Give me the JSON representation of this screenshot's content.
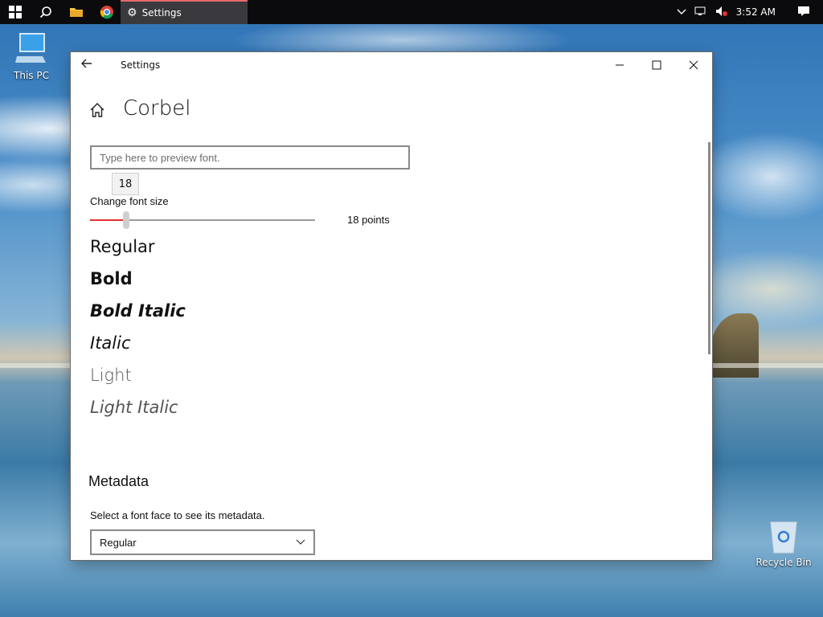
{
  "taskbar": {
    "active_app_label": "Settings",
    "clock": "3:52 AM"
  },
  "desktop": {
    "icons": [
      {
        "label": "This PC"
      },
      {
        "label": "Recycle Bin"
      }
    ]
  },
  "window": {
    "title": "Settings",
    "font_name": "Corbel",
    "preview_placeholder": "Type here to preview font.",
    "size_tooltip": "18",
    "size_label": "Change font size",
    "size_value_text": "18 points",
    "size_fraction": 0.16,
    "faces": [
      "Regular",
      "Bold",
      "Bold Italic",
      "Italic",
      "Light",
      "Light Italic"
    ],
    "metadata_title": "Metadata",
    "metadata_prompt": "Select a font face to see its metadata.",
    "metadata_selected": "Regular"
  },
  "colors": {
    "accent": "#e03030",
    "taskbar": "#0b0b0d"
  }
}
